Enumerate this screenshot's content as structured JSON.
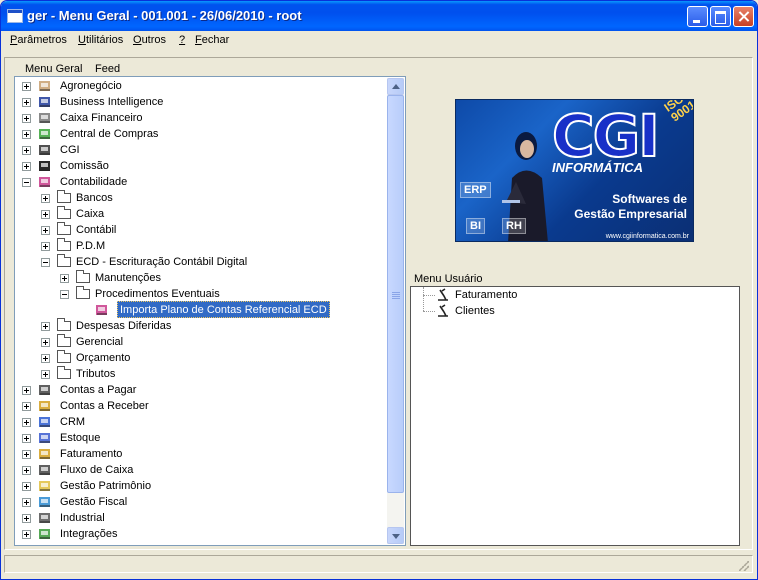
{
  "window": {
    "title": "ger - Menu Geral - 001.001 - 26/06/2010 - root"
  },
  "menubar": {
    "items": [
      {
        "label": "Parâmetros",
        "accel_index": 0
      },
      {
        "label": "Utilitários",
        "accel_index": 0
      },
      {
        "label": "Outros",
        "accel_index": 0
      },
      {
        "label": "?",
        "accel_index": 0
      },
      {
        "label": "Fechar",
        "accel_index": 0
      }
    ]
  },
  "tabs": [
    {
      "label": "Menu Geral"
    },
    {
      "label": "Feed"
    }
  ],
  "tree": {
    "nodes": [
      {
        "label": "Agronegócio",
        "level": 0,
        "expander": "plus",
        "icon": "agro-icon",
        "color": "#c8a070"
      },
      {
        "label": "Business Intelligence",
        "level": 0,
        "expander": "plus",
        "icon": "bi-icon",
        "color": "#1e3a9a"
      },
      {
        "label": "Caixa Financeiro",
        "level": 0,
        "expander": "plus",
        "icon": "cash-register-icon",
        "color": "#777777"
      },
      {
        "label": "Central de Compras",
        "level": 0,
        "expander": "plus",
        "icon": "shopping-icon",
        "color": "#3aa43a"
      },
      {
        "label": "CGI",
        "level": 0,
        "expander": "plus",
        "icon": "cgi-icon",
        "color": "#333333"
      },
      {
        "label": "Comissão",
        "level": 0,
        "expander": "plus",
        "icon": "percent-icon",
        "color": "#000000"
      },
      {
        "label": "Contabilidade",
        "level": 0,
        "expander": "minus",
        "icon": "accounting-icon",
        "color": "#c83a8a"
      },
      {
        "label": "Bancos",
        "level": 1,
        "expander": "plus",
        "icon": "folder-icon"
      },
      {
        "label": "Caixa",
        "level": 1,
        "expander": "plus",
        "icon": "folder-icon"
      },
      {
        "label": "Contábil",
        "level": 1,
        "expander": "plus",
        "icon": "folder-icon"
      },
      {
        "label": "P.D.M",
        "level": 1,
        "expander": "plus",
        "icon": "folder-icon"
      },
      {
        "label": "ECD - Escrituração Contábil Digital",
        "level": 1,
        "expander": "minus",
        "icon": "folder-icon"
      },
      {
        "label": "Manutenções",
        "level": 2,
        "expander": "plus",
        "icon": "folder-icon"
      },
      {
        "label": "Procedimentos Eventuais",
        "level": 2,
        "expander": "minus",
        "icon": "folder-icon"
      },
      {
        "label": "Importa Plano de Contas Referencial ECD",
        "level": 3,
        "expander": "none",
        "icon": "program-icon",
        "color": "#c83a8a",
        "selected": true
      },
      {
        "label": "Despesas Diferidas",
        "level": 1,
        "expander": "plus",
        "icon": "folder-icon"
      },
      {
        "label": "Gerencial",
        "level": 1,
        "expander": "plus",
        "icon": "folder-icon"
      },
      {
        "label": "Orçamento",
        "level": 1,
        "expander": "plus",
        "icon": "folder-icon"
      },
      {
        "label": "Tributos",
        "level": 1,
        "expander": "plus",
        "icon": "folder-icon"
      },
      {
        "label": "Contas a Pagar",
        "level": 0,
        "expander": "plus",
        "icon": "payable-icon",
        "color": "#444444"
      },
      {
        "label": "Contas a Receber",
        "level": 0,
        "expander": "plus",
        "icon": "receivable-icon",
        "color": "#d4a020"
      },
      {
        "label": "CRM",
        "level": 0,
        "expander": "plus",
        "icon": "crm-icon",
        "color": "#2a5ad0"
      },
      {
        "label": "Estoque",
        "level": 0,
        "expander": "plus",
        "icon": "stock-icon",
        "color": "#3a5ad0"
      },
      {
        "label": "Faturamento",
        "level": 0,
        "expander": "plus",
        "icon": "billing-icon",
        "color": "#d4a020"
      },
      {
        "label": "Fluxo de Caixa",
        "level": 0,
        "expander": "plus",
        "icon": "cashflow-icon",
        "color": "#444444"
      },
      {
        "label": "Gestão Patrimônio",
        "level": 0,
        "expander": "plus",
        "icon": "asset-icon",
        "color": "#e0c040"
      },
      {
        "label": "Gestão Fiscal",
        "level": 0,
        "expander": "plus",
        "icon": "fiscal-icon",
        "color": "#2a8ad0"
      },
      {
        "label": "Industrial",
        "level": 0,
        "expander": "plus",
        "icon": "gear-icon",
        "color": "#555555"
      },
      {
        "label": "Integrações",
        "level": 0,
        "expander": "plus",
        "icon": "integration-icon",
        "color": "#3a9a3a"
      }
    ]
  },
  "logo": {
    "brand": "CGI",
    "subtitle": "INFORMÁTICA",
    "iso_line1": "ISO",
    "iso_line2": "9001",
    "tagline1": "Softwares de",
    "tagline2": "Gestão Empresarial",
    "website": "www.cgiinformatica.com.br",
    "tags": [
      "ERP",
      "BI",
      "RH"
    ]
  },
  "user_menu": {
    "label": "Menu Usuário",
    "items": [
      {
        "label": "Faturamento",
        "icon": "microscope-icon"
      },
      {
        "label": "Clientes",
        "icon": "microscope-icon"
      }
    ]
  }
}
